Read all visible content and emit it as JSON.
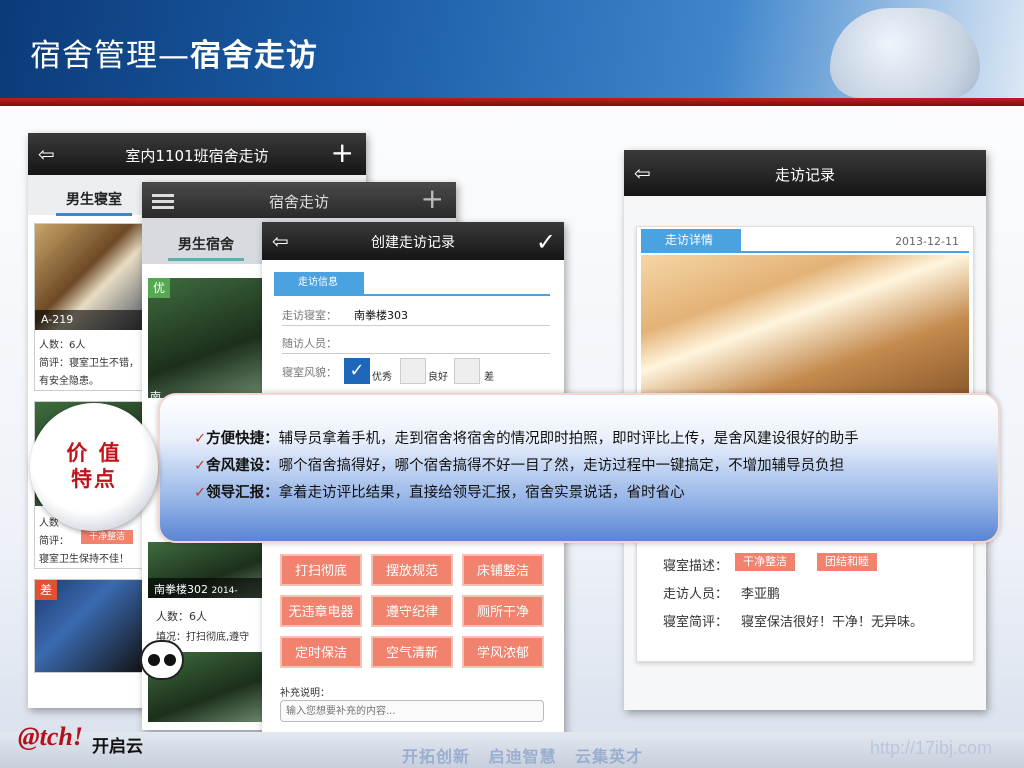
{
  "slide": {
    "title_prefix": "宿舍管理—",
    "title_bold": "宿舍走访"
  },
  "phone1": {
    "title": "室内1101班宿舍走访",
    "tab": "男生寝室",
    "card1": {
      "caption": "A-219",
      "people": "人数：6人",
      "review": "简评：寝室卫生不错，",
      "review2": "有安全隐患。"
    },
    "card2": {
      "tag": "干净整洁",
      "review_label": "简评：",
      "review": "寝室卫生保持不佳！",
      "partial": "人数"
    },
    "card3": {
      "badge": "差"
    }
  },
  "phone2": {
    "title": "宿舍走访",
    "tab": "男生宿舍",
    "badge": "优",
    "partial_caption": "南",
    "card_caption": "南拳楼302",
    "card_caption_date": "2014-",
    "people": "人数：6人",
    "fill": "填况：打扫彻底,遵守"
  },
  "phone3": {
    "title": "创建走访记录",
    "section": "走访信息",
    "room_label": "走访寝室：",
    "room_value": "南拳楼303",
    "companion_label": "随访人员：",
    "style_label": "寝室风貌：",
    "options": [
      "优秀",
      "良好",
      "差"
    ],
    "tags": [
      "打扫彻底",
      "摆放规范",
      "床铺整洁",
      "无违章电器",
      "遵守纪律",
      "厕所干净",
      "定时保洁",
      "空气清新",
      "学风浓郁"
    ],
    "note_label": "补充说明：",
    "note_placeholder": "输入您想要补充的内容..."
  },
  "phone4": {
    "title": "走访记录",
    "section": "走访详情",
    "date": "2013-12-11",
    "desc_label": "寝室描述：",
    "desc_tags": [
      "干净整洁",
      "团结和睦"
    ],
    "visitor_label": "走访人员：",
    "visitor": "李亚鹏",
    "review_label": "寝室简评：",
    "review": "寝室保洁很好！干净！无异味。"
  },
  "value": {
    "circle_line1": "价 值",
    "circle_line2": "特点",
    "items": [
      {
        "head": "方便快捷：",
        "text": "辅导员拿着手机，走到宿舍将宿舍的情况即时拍照，即时评比上传，是舍风建设很好的助手"
      },
      {
        "head": "舍风建设：",
        "text": "哪个宿舍搞得好，哪个宿舍搞得不好一目了然，走访过程中一键搞定，不增加辅导员负担"
      },
      {
        "head": "领导汇报：",
        "text": "拿着走访评比结果，直接给领导汇报，宿舍实景说话，省时省心"
      }
    ]
  },
  "footer": {
    "logo": "@tch!",
    "logo_cn": "开启云",
    "slogan": "开拓创新 启迪智慧 云集英才",
    "url": "http://17ibj.com"
  },
  "colors": {
    "accent": "#4aa3e0",
    "tag": "#f0826e",
    "header": "#1a5ca6",
    "stripe": "#c21e22"
  }
}
